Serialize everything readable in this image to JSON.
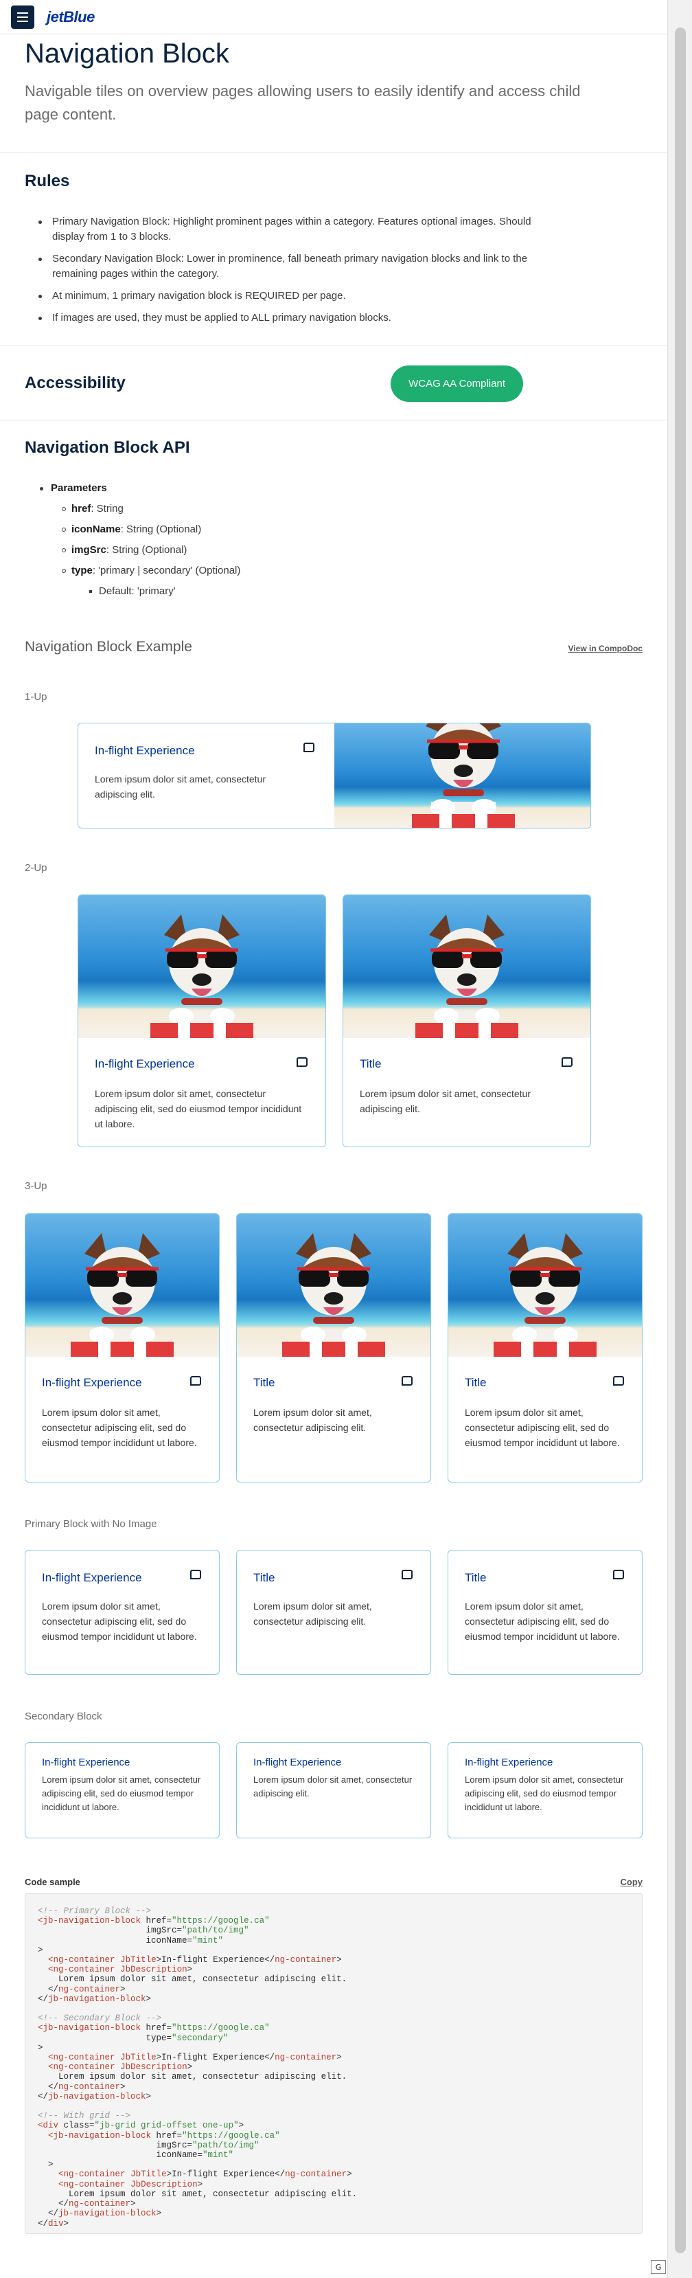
{
  "header": {
    "brand": "jetBlue"
  },
  "page": {
    "title": "Navigation Block",
    "subtitle": "Navigable tiles on overview pages allowing users to easily identify and access child page content."
  },
  "rules": {
    "title": "Rules",
    "items": [
      "Primary Navigation Block: Highlight prominent pages within a category. Features optional images. Should display from 1 to 3 blocks.",
      "Secondary Navigation Block: Lower in prominence, fall beneath primary navigation blocks and link to the remaining pages within the category.",
      "At minimum, 1 primary navigation block is REQUIRED per page.",
      "If images are used, they must be applied to ALL primary navigation blocks."
    ]
  },
  "accessibility": {
    "title": "Accessibility",
    "badge": "WCAG AA Compliant"
  },
  "api": {
    "title": "Navigation Block API",
    "params_label": "Parameters",
    "params": [
      {
        "name": "href",
        "desc": ": String"
      },
      {
        "name": "iconName",
        "desc": ": String (Optional)"
      },
      {
        "name": "imgSrc",
        "desc": ": String (Optional)"
      },
      {
        "name": "type",
        "desc": ": 'primary | secondary' (Optional)"
      }
    ],
    "default": "Default: 'primary'"
  },
  "example": {
    "title": "Navigation Block Example",
    "link": "View in CompoDoc",
    "labels": {
      "one_up": "1-Up",
      "two_up": "2-Up",
      "three_up": "3-Up",
      "no_image": "Primary Block with No Image",
      "secondary": "Secondary Block"
    },
    "cards": {
      "inflight": "In-flight Experience",
      "title": "Title",
      "short": "Lorem ipsum dolor sit amet, consectetur adipiscing elit.",
      "long": "Lorem ipsum dolor sit amet, consectetur adipiscing elit, sed do eiusmod tempor incididunt ut labore."
    },
    "icon": "chat-bubble-icon"
  },
  "code": {
    "label": "Code sample",
    "copy": "Copy"
  },
  "corner_button": "G"
}
